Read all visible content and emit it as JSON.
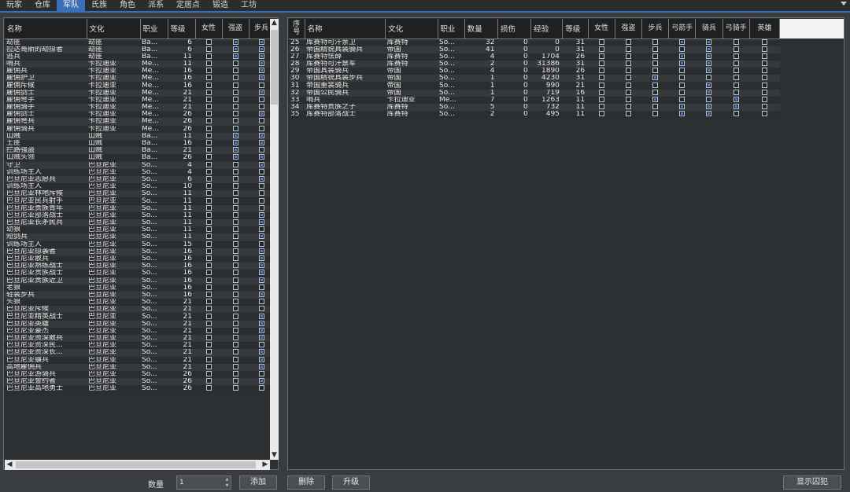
{
  "tabs": [
    {
      "label": "玩家",
      "active": false
    },
    {
      "label": "仓库",
      "active": false
    },
    {
      "label": "军队",
      "active": true
    },
    {
      "label": "氏族",
      "active": false
    },
    {
      "label": "角色",
      "active": false
    },
    {
      "label": "派系",
      "active": false
    },
    {
      "label": "定居点",
      "active": false
    },
    {
      "label": "锻造",
      "active": false
    },
    {
      "label": "工坊",
      "active": false
    }
  ],
  "left_table": {
    "columns": [
      "名称",
      "文化",
      "职业",
      "等级",
      "女性",
      "强盗",
      "步兵"
    ],
    "rows": [
      {
        "name": "劫匪",
        "culture": "劫匪",
        "occupation": "Ba...",
        "level": "6",
        "checks": [
          0,
          1,
          1
        ]
      },
      {
        "name": "拉达哥斯的劫掠者",
        "culture": "劫匪",
        "occupation": "Ba...",
        "level": "6",
        "checks": [
          0,
          1,
          1
        ]
      },
      {
        "name": "逃兵",
        "culture": "劫匪",
        "occupation": "Ba...",
        "level": "11",
        "checks": [
          0,
          1,
          1
        ]
      },
      {
        "name": "哨兵",
        "culture": "卡拉迪亚",
        "occupation": "Me...",
        "level": "11",
        "checks": [
          0,
          0,
          1
        ]
      },
      {
        "name": "雇佣兵",
        "culture": "卡拉迪亚",
        "occupation": "Me...",
        "level": "16",
        "checks": [
          0,
          0,
          1
        ]
      },
      {
        "name": "雇佣护卫",
        "culture": "卡拉迪亚",
        "occupation": "Me...",
        "level": "16",
        "checks": [
          0,
          0,
          1
        ]
      },
      {
        "name": "雇佣斥候",
        "culture": "卡拉迪亚",
        "occupation": "Me...",
        "level": "16",
        "checks": [
          0,
          0,
          0
        ]
      },
      {
        "name": "雇佣剑士",
        "culture": "卡拉迪亚",
        "occupation": "Me...",
        "level": "21",
        "checks": [
          0,
          0,
          1
        ]
      },
      {
        "name": "雇佣弩手",
        "culture": "卡拉迪亚",
        "occupation": "Me...",
        "level": "21",
        "checks": [
          0,
          0,
          0
        ]
      },
      {
        "name": "雇佣骑手",
        "culture": "卡拉迪亚",
        "occupation": "Me...",
        "level": "21",
        "checks": [
          0,
          0,
          0
        ]
      },
      {
        "name": "雇佣剑士",
        "culture": "卡拉迪亚",
        "occupation": "Me...",
        "level": "26",
        "checks": [
          0,
          0,
          1
        ]
      },
      {
        "name": "雇佣弩兵",
        "culture": "卡拉迪亚",
        "occupation": "Me...",
        "level": "26",
        "checks": [
          0,
          0,
          0
        ]
      },
      {
        "name": "雇佣骑兵",
        "culture": "卡拉迪亚",
        "occupation": "Me...",
        "level": "26",
        "checks": [
          0,
          0,
          0
        ]
      },
      {
        "name": "山贼",
        "culture": "山贼",
        "occupation": "Ba...",
        "level": "11",
        "checks": [
          0,
          1,
          1
        ]
      },
      {
        "name": "土匪",
        "culture": "山贼",
        "occupation": "Ba...",
        "level": "16",
        "checks": [
          0,
          1,
          1
        ]
      },
      {
        "name": "拦路强盗",
        "culture": "山贼",
        "occupation": "Ba...",
        "level": "21",
        "checks": [
          0,
          1,
          0
        ]
      },
      {
        "name": "山贼头领",
        "culture": "山贼",
        "occupation": "Ba...",
        "level": "26",
        "checks": [
          0,
          1,
          1
        ]
      },
      {
        "name": "守卫",
        "culture": "巴旦尼亚",
        "occupation": "So...",
        "level": "4",
        "checks": [
          0,
          0,
          1
        ]
      },
      {
        "name": "训练场主人",
        "culture": "巴旦尼亚",
        "occupation": "So...",
        "level": "4",
        "checks": [
          0,
          0,
          0
        ]
      },
      {
        "name": "巴旦尼亚志愿兵",
        "culture": "巴旦尼亚",
        "occupation": "So...",
        "level": "6",
        "checks": [
          0,
          0,
          1
        ]
      },
      {
        "name": "训练场主人",
        "culture": "巴旦尼亚",
        "occupation": "So...",
        "level": "10",
        "checks": [
          0,
          0,
          0
        ]
      },
      {
        "name": "巴旦尼亚林地斥候",
        "culture": "巴旦尼亚",
        "occupation": "So...",
        "level": "11",
        "checks": [
          0,
          0,
          0
        ]
      },
      {
        "name": "巴旦尼亚民兵射手",
        "culture": "巴旦尼亚",
        "occupation": "So...",
        "level": "11",
        "checks": [
          0,
          0,
          0
        ]
      },
      {
        "name": "巴旦尼亚贵族青年",
        "culture": "巴旦尼亚",
        "occupation": "So...",
        "level": "11",
        "checks": [
          0,
          0,
          0
        ]
      },
      {
        "name": "巴旦尼亚部落战士",
        "culture": "巴旦尼亚",
        "occupation": "So...",
        "level": "11",
        "checks": [
          0,
          0,
          1
        ]
      },
      {
        "name": "巴旦尼亚长矛民兵",
        "culture": "巴旦尼亚",
        "occupation": "So...",
        "level": "11",
        "checks": [
          0,
          0,
          1
        ]
      },
      {
        "name": "幼狼",
        "culture": "巴旦尼亚",
        "occupation": "So...",
        "level": "11",
        "checks": [
          0,
          0,
          0
        ]
      },
      {
        "name": "短剑兵",
        "culture": "巴旦尼亚",
        "occupation": "So...",
        "level": "11",
        "checks": [
          0,
          0,
          1
        ]
      },
      {
        "name": "训练场主人",
        "culture": "巴旦尼亚",
        "occupation": "So...",
        "level": "15",
        "checks": [
          0,
          0,
          0
        ]
      },
      {
        "name": "巴旦尼亚掠袭者",
        "culture": "巴旦尼亚",
        "occupation": "So...",
        "level": "16",
        "checks": [
          0,
          0,
          1
        ]
      },
      {
        "name": "巴旦尼亚散兵",
        "culture": "巴旦尼亚",
        "occupation": "So...",
        "level": "16",
        "checks": [
          0,
          0,
          1
        ]
      },
      {
        "name": "巴旦尼亚熟练战士",
        "culture": "巴旦尼亚",
        "occupation": "So...",
        "level": "16",
        "checks": [
          0,
          0,
          1
        ]
      },
      {
        "name": "巴旦尼亚贵族战士",
        "culture": "巴旦尼亚",
        "occupation": "So...",
        "level": "16",
        "checks": [
          0,
          0,
          1
        ]
      },
      {
        "name": "巴旦尼亚贵族近卫",
        "culture": "巴旦尼亚",
        "occupation": "So...",
        "level": "16",
        "checks": [
          0,
          0,
          1
        ]
      },
      {
        "name": "老狼",
        "culture": "巴旦尼亚",
        "occupation": "So...",
        "level": "16",
        "checks": [
          0,
          0,
          0
        ]
      },
      {
        "name": "轻装步兵",
        "culture": "巴旦尼亚",
        "occupation": "So...",
        "level": "16",
        "checks": [
          0,
          0,
          1
        ]
      },
      {
        "name": "头狼",
        "culture": "巴旦尼亚",
        "occupation": "So...",
        "level": "21",
        "checks": [
          0,
          0,
          0
        ]
      },
      {
        "name": "巴旦尼亚斥候",
        "culture": "巴旦尼亚",
        "occupation": "So...",
        "level": "21",
        "checks": [
          0,
          0,
          0
        ]
      },
      {
        "name": "巴旦尼亚精英战士",
        "culture": "巴旦尼亚",
        "occupation": "So...",
        "level": "21",
        "checks": [
          0,
          0,
          1
        ]
      },
      {
        "name": "巴旦尼亚英雄",
        "culture": "巴旦尼亚",
        "occupation": "So...",
        "level": "21",
        "checks": [
          0,
          0,
          1
        ]
      },
      {
        "name": "巴旦尼亚豪杰",
        "culture": "巴旦尼亚",
        "occupation": "So...",
        "level": "21",
        "checks": [
          0,
          0,
          1
        ]
      },
      {
        "name": "巴旦尼亚资深散兵",
        "culture": "巴旦尼亚",
        "occupation": "So...",
        "level": "21",
        "checks": [
          0,
          0,
          1
        ]
      },
      {
        "name": "巴旦尼亚资深民...",
        "culture": "巴旦尼亚",
        "occupation": "So...",
        "level": "21",
        "checks": [
          0,
          0,
          0
        ]
      },
      {
        "name": "巴旦尼亚资深长...",
        "culture": "巴旦尼亚",
        "occupation": "So...",
        "level": "21",
        "checks": [
          0,
          0,
          1
        ]
      },
      {
        "name": "巴旦尼亚镰兵",
        "culture": "巴旦尼亚",
        "occupation": "So...",
        "level": "21",
        "checks": [
          0,
          0,
          1
        ]
      },
      {
        "name": "高地雇佣兵",
        "culture": "巴旦尼亚",
        "occupation": "So...",
        "level": "21",
        "checks": [
          0,
          0,
          1
        ]
      },
      {
        "name": "巴旦尼亚游骑兵",
        "culture": "巴旦尼亚",
        "occupation": "So...",
        "level": "26",
        "checks": [
          0,
          0,
          0
        ]
      },
      {
        "name": "巴旦尼亚誓约者",
        "culture": "巴旦尼亚",
        "occupation": "So...",
        "level": "26",
        "checks": [
          0,
          0,
          1
        ]
      },
      {
        "name": "巴旦尼亚高地勇士",
        "culture": "巴旦尼亚",
        "occupation": "So...",
        "level": "26",
        "checks": [
          0,
          0,
          0
        ]
      }
    ]
  },
  "right_table": {
    "columns": [
      "序号",
      "名称",
      "文化",
      "职业",
      "数量",
      "损伤",
      "经验",
      "等级",
      "女性",
      "强盗",
      "步兵",
      "弓箭手",
      "骑兵",
      "弓骑手",
      "英雄"
    ],
    "rows": [
      {
        "idx": "25",
        "name": "库赛特可汗亲卫",
        "culture": "库赛特",
        "occupation": "So...",
        "count": "32",
        "wounded": "0",
        "xp": "0",
        "level": "31",
        "checks": [
          0,
          0,
          0,
          1,
          1,
          0,
          0
        ]
      },
      {
        "idx": "26",
        "name": "帝国精锐具装骑兵",
        "culture": "帝国",
        "occupation": "So...",
        "count": "41",
        "wounded": "0",
        "xp": "0",
        "level": "31",
        "checks": [
          0,
          0,
          0,
          0,
          1,
          0,
          0
        ]
      },
      {
        "idx": "27",
        "name": "库赛特怯薛",
        "culture": "库赛特",
        "occupation": "So...",
        "count": "4",
        "wounded": "0",
        "xp": "1704",
        "level": "26",
        "checks": [
          0,
          0,
          0,
          1,
          1,
          0,
          0
        ]
      },
      {
        "idx": "28",
        "name": "库赛特可汗禁军",
        "culture": "库赛特",
        "occupation": "So...",
        "count": "2",
        "wounded": "0",
        "xp": "31386",
        "level": "31",
        "checks": [
          0,
          0,
          0,
          1,
          1,
          0,
          0
        ]
      },
      {
        "idx": "29",
        "name": "帝国具装骑兵",
        "culture": "帝国",
        "occupation": "So...",
        "count": "4",
        "wounded": "0",
        "xp": "1890",
        "level": "26",
        "checks": [
          0,
          0,
          0,
          0,
          1,
          0,
          0
        ]
      },
      {
        "idx": "30",
        "name": "帝国精锐具装步兵",
        "culture": "帝国",
        "occupation": "So...",
        "count": "1",
        "wounded": "0",
        "xp": "4230",
        "level": "31",
        "checks": [
          0,
          0,
          1,
          0,
          0,
          0,
          0
        ]
      },
      {
        "idx": "31",
        "name": "帝国重装骑兵",
        "culture": "帝国",
        "occupation": "So...",
        "count": "1",
        "wounded": "0",
        "xp": "990",
        "level": "21",
        "checks": [
          0,
          0,
          0,
          0,
          1,
          0,
          0
        ]
      },
      {
        "idx": "32",
        "name": "帝国公民骑兵",
        "culture": "帝国",
        "occupation": "So...",
        "count": "1",
        "wounded": "0",
        "xp": "719",
        "level": "16",
        "checks": [
          0,
          0,
          0,
          0,
          1,
          0,
          0
        ]
      },
      {
        "idx": "33",
        "name": "哨兵",
        "culture": "卡拉迪亚",
        "occupation": "Me...",
        "count": "7",
        "wounded": "0",
        "xp": "1263",
        "level": "11",
        "checks": [
          0,
          0,
          1,
          0,
          0,
          1,
          0
        ]
      },
      {
        "idx": "34",
        "name": "库赛特贵族之子",
        "culture": "库赛特",
        "occupation": "So...",
        "count": "5",
        "wounded": "0",
        "xp": "732",
        "level": "11",
        "checks": [
          0,
          0,
          0,
          1,
          1,
          1,
          0
        ]
      },
      {
        "idx": "35",
        "name": "库赛特部落战士",
        "culture": "库赛特",
        "occupation": "So...",
        "count": "2",
        "wounded": "0",
        "xp": "495",
        "level": "11",
        "checks": [
          0,
          0,
          0,
          1,
          1,
          0,
          0
        ]
      }
    ]
  },
  "bottom": {
    "qty_label": "数量",
    "qty_value": "1",
    "add_label": "添加",
    "delete_label": "删除",
    "upgrade_label": "升级",
    "show_prisoners_label": "显示囚犯"
  },
  "icons": {
    "scroll_up": "▲",
    "scroll_down": "▼",
    "scroll_left": "◀",
    "scroll_right": "▶"
  },
  "colors": {
    "accent": "#3b6fb6",
    "checkbox_on": "#4b7bd0"
  }
}
